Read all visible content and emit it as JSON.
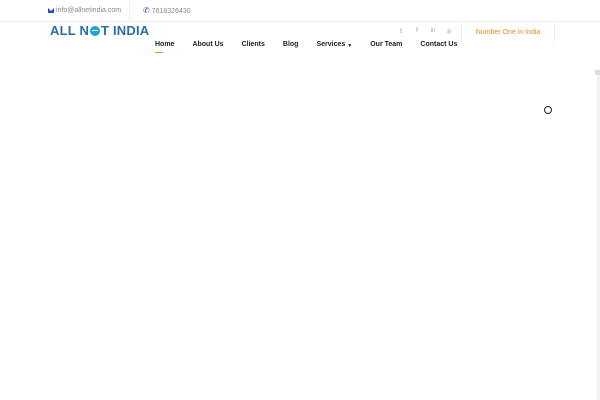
{
  "topbar": {
    "email": "info@allnetindia.com",
    "phone": "7618326430",
    "email_icon": "envelope-icon",
    "phone_icon": "phone-icon"
  },
  "logo": {
    "text_part1": "ALL N",
    "text_part2": "T INDIA"
  },
  "social": {
    "twitter": "𝕥",
    "facebook": "f",
    "linkedin": "in",
    "instagram": "◎"
  },
  "tagline": "Number One in India",
  "nav": {
    "items": [
      {
        "label": "Home"
      },
      {
        "label": "About Us"
      },
      {
        "label": "Clients"
      },
      {
        "label": "Blog"
      },
      {
        "label": "Services"
      },
      {
        "label": "Our Team"
      },
      {
        "label": "Contact Us"
      }
    ]
  },
  "colors": {
    "accent": "#e8871e",
    "brand": "#2a6ea8"
  }
}
